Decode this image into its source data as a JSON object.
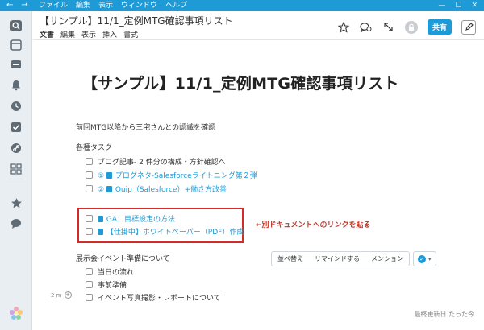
{
  "titlebar": {
    "back": "←",
    "forward": "→",
    "menu": [
      "ファイル",
      "編集",
      "表示",
      "ウィンドウ",
      "ヘルプ"
    ],
    "minimize": "—",
    "maximize": "☐",
    "close": "✕"
  },
  "sidebar": {
    "icons": [
      "search-icon",
      "inbox-icon",
      "archive-icon",
      "bell-icon",
      "clock-icon",
      "checkbox-icon",
      "link-icon",
      "grid-icon",
      "star-icon",
      "chat-icon"
    ]
  },
  "header": {
    "title": "【サンプル】11/1_定例MTG確認事項リスト",
    "menu": [
      "文書",
      "編集",
      "表示",
      "挿入",
      "書式"
    ],
    "share_label": "共有"
  },
  "doc": {
    "title": "【サンプル】11/1_定例MTG確認事項リスト",
    "intro": "前回MTG以降から三宅さんとの認識を確認",
    "section1": "各種タスク",
    "tasks": [
      {
        "text": "ブログ記事- 2 件分の構成・方針確認へ"
      },
      {
        "prefix": "①",
        "link": "プログネタ-Salesforceライトニング第２弾"
      },
      {
        "prefix": "②",
        "link": "Quip（Salesforce）+働き方改善"
      }
    ],
    "linked_tasks": [
      {
        "link": "GA：目標設定の方法"
      },
      {
        "link": "【仕掛中】ホワイトペーパー（PDF）作成"
      }
    ],
    "annotation": "←別ドキュメントへのリンクを貼る",
    "section2": "展示会イベント準備について",
    "event_tasks": [
      {
        "text": "当日の流れ"
      },
      {
        "text": "事前準備"
      },
      {
        "text": "イベント写真撮影・レポートについて"
      }
    ],
    "gutter_time": "2 m",
    "format_bar": [
      "並べ替え",
      "リマインドする",
      "メンション"
    ],
    "footer": "最終更新日 たった今"
  },
  "colors": {
    "accent": "#1e9bd7",
    "annotation": "#d42a2a"
  }
}
